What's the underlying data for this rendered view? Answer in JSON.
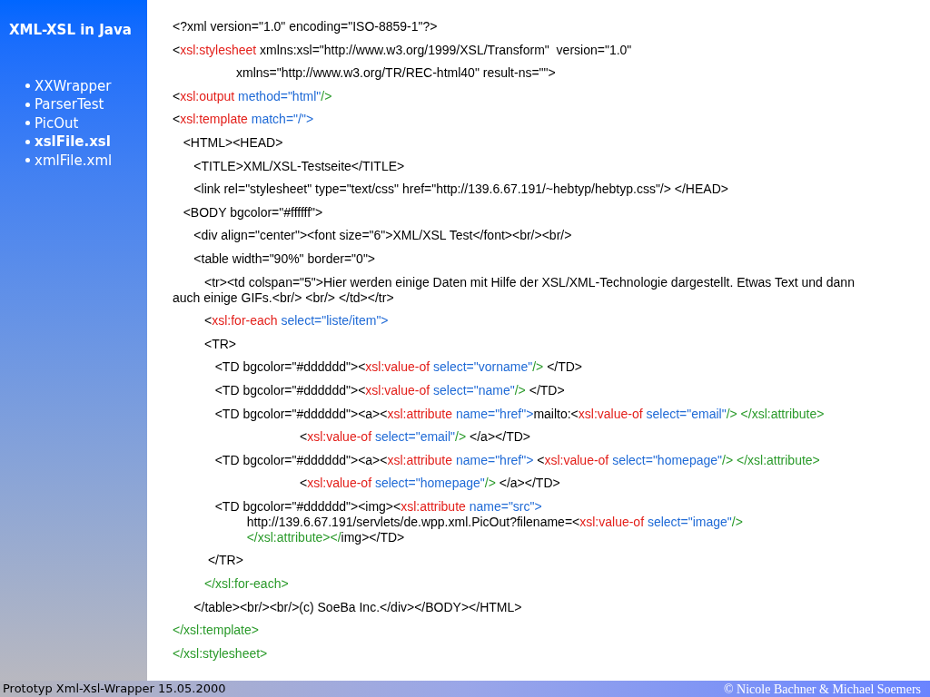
{
  "sidebar": {
    "title": "XML-XSL in Java",
    "items": [
      {
        "label": "XXWrapper",
        "selected": false
      },
      {
        "label": "ParserTest",
        "selected": false
      },
      {
        "label": "PicOut",
        "selected": false
      },
      {
        "label": "xslFile.xsl",
        "selected": true
      },
      {
        "label": "xmlFile.xml",
        "selected": false
      }
    ]
  },
  "code": [
    {
      "lines": [
        [
          {
            "kind": "text",
            "text": "<?xml version=\"1.0\" encoding=\"ISO-8859-1\"?>"
          }
        ]
      ]
    },
    {
      "lines": [
        [
          {
            "kind": "text",
            "text": "<"
          },
          {
            "kind": "keyword",
            "text": "xsl:stylesheet"
          },
          {
            "kind": "text",
            "text": " xmlns:xsl=\"http://www.w3.org/1999/XSL/Transform\"  version=\"1.0\""
          }
        ]
      ]
    },
    {
      "lines": [
        [
          {
            "kind": "text",
            "text": "                  xmlns=\"http://www.w3.org/TR/REC-html40\" result-ns=\"\">"
          }
        ]
      ]
    },
    {
      "lines": [
        [
          {
            "kind": "text",
            "text": "<"
          },
          {
            "kind": "keyword",
            "text": "xsl:output"
          },
          {
            "kind": "attr",
            "text": " method=\"html\""
          },
          {
            "kind": "close",
            "text": "/>"
          }
        ]
      ]
    },
    {
      "lines": [
        [
          {
            "kind": "text",
            "text": "<"
          },
          {
            "kind": "keyword",
            "text": "xsl:template"
          },
          {
            "kind": "attr",
            "text": " match=\"/\">"
          }
        ]
      ]
    },
    {
      "lines": [
        [
          {
            "kind": "text",
            "text": "   <HTML><HEAD>"
          }
        ]
      ]
    },
    {
      "lines": [
        [
          {
            "kind": "text",
            "text": "      <TITLE>XML/XSL-Testseite</TITLE>"
          }
        ]
      ]
    },
    {
      "lines": [
        [
          {
            "kind": "text",
            "text": "      <link rel=\"stylesheet\" type=\"text/css\" href=\"http://139.6.67.191/~hebtyp/hebtyp.css\"/> </HEAD>"
          }
        ]
      ]
    },
    {
      "lines": [
        [
          {
            "kind": "text",
            "text": "   <BODY bgcolor=\"#ffffff\">"
          }
        ]
      ]
    },
    {
      "lines": [
        [
          {
            "kind": "text",
            "text": "      <div align=\"center\"><font size=\"6\">XML/XSL Test</font><br/><br/>"
          }
        ]
      ]
    },
    {
      "lines": [
        [
          {
            "kind": "text",
            "text": "      <table width=\"90%\" border=\"0\">"
          }
        ]
      ]
    },
    {
      "lines": [
        [
          {
            "kind": "text",
            "text": "         <tr><td colspan=\"5\">Hier werden einige Daten mit Hilfe der XSL/XML-Technologie dargestellt. Etwas Text und dann auch einige GIFs.<br/> <br/> </td></tr>"
          }
        ]
      ]
    },
    {
      "lines": [
        [
          {
            "kind": "text",
            "text": "         <"
          },
          {
            "kind": "keyword",
            "text": "xsl:for-each"
          },
          {
            "kind": "attr",
            "text": " select=\"liste/item\">"
          }
        ]
      ]
    },
    {
      "lines": [
        [
          {
            "kind": "text",
            "text": "         <TR>"
          }
        ]
      ]
    },
    {
      "lines": [
        [
          {
            "kind": "text",
            "text": "            <TD bgcolor=\"#dddddd\"><"
          },
          {
            "kind": "keyword",
            "text": "xsl:value-of"
          },
          {
            "kind": "attr",
            "text": " select=\"vorname\""
          },
          {
            "kind": "close",
            "text": "/>"
          },
          {
            "kind": "text",
            "text": " </TD>"
          }
        ]
      ]
    },
    {
      "lines": [
        [
          {
            "kind": "text",
            "text": "            <TD bgcolor=\"#dddddd\"><"
          },
          {
            "kind": "keyword",
            "text": "xsl:value-of"
          },
          {
            "kind": "attr",
            "text": " select=\"name\""
          },
          {
            "kind": "close",
            "text": "/>"
          },
          {
            "kind": "text",
            "text": " </TD>"
          }
        ]
      ]
    },
    {
      "lines": [
        [
          {
            "kind": "text",
            "text": "            <TD bgcolor=\"#dddddd\"><a><"
          },
          {
            "kind": "keyword",
            "text": "xsl:attribute"
          },
          {
            "kind": "attr",
            "text": " name=\"href\">"
          },
          {
            "kind": "text",
            "text": "mailto:<"
          },
          {
            "kind": "keyword",
            "text": "xsl:value-of"
          },
          {
            "kind": "attr",
            "text": " select=\"email\""
          },
          {
            "kind": "close",
            "text": "/> </xsl:attribute>"
          }
        ]
      ]
    },
    {
      "lines": [
        [
          {
            "kind": "text",
            "text": "                                    <"
          },
          {
            "kind": "keyword",
            "text": "xsl:value-of"
          },
          {
            "kind": "attr",
            "text": " select=\"email\""
          },
          {
            "kind": "close",
            "text": "/>"
          },
          {
            "kind": "text",
            "text": " </a></TD>"
          }
        ]
      ]
    },
    {
      "lines": [
        [
          {
            "kind": "text",
            "text": "            <TD bgcolor=\"#dddddd\"><a><"
          },
          {
            "kind": "keyword",
            "text": "xsl:attribute"
          },
          {
            "kind": "attr",
            "text": " name=\"href\">"
          },
          {
            "kind": "text",
            "text": " <"
          },
          {
            "kind": "keyword",
            "text": "xsl:value-of"
          },
          {
            "kind": "attr",
            "text": " select=\"homepage\""
          },
          {
            "kind": "close",
            "text": "/> </xsl:attribute>"
          }
        ]
      ]
    },
    {
      "lines": [
        [
          {
            "kind": "text",
            "text": "                                    <"
          },
          {
            "kind": "keyword",
            "text": "xsl:value-of"
          },
          {
            "kind": "attr",
            "text": " select=\"homepage\""
          },
          {
            "kind": "close",
            "text": "/>"
          },
          {
            "kind": "text",
            "text": " </a></TD>"
          }
        ]
      ]
    },
    {
      "lines": [
        [
          {
            "kind": "text",
            "text": "            <TD bgcolor=\"#dddddd\"><img><"
          },
          {
            "kind": "keyword",
            "text": "xsl:attribute"
          },
          {
            "kind": "attr",
            "text": " name=\"src\">"
          }
        ],
        [
          {
            "kind": "text",
            "text": "                     http://139.6.67.191/servlets/de.wpp.xml.PicOut?filename=<"
          },
          {
            "kind": "keyword",
            "text": "xsl:value-of"
          },
          {
            "kind": "attr",
            "text": " select=\"image\""
          },
          {
            "kind": "close",
            "text": "/>"
          }
        ],
        [
          {
            "kind": "close",
            "text": "                     </xsl:attribute></"
          },
          {
            "kind": "text",
            "text": "img></TD>"
          }
        ]
      ]
    },
    {
      "lines": [
        [
          {
            "kind": "text",
            "text": "          </TR>"
          }
        ]
      ]
    },
    {
      "lines": [
        [
          {
            "kind": "close",
            "text": "         </xsl:for-each>"
          }
        ]
      ]
    },
    {
      "lines": [
        [
          {
            "kind": "text",
            "text": "      </table><br/><br/>(c) SoeBa Inc.</div></BODY></HTML>"
          }
        ]
      ]
    },
    {
      "lines": [
        [
          {
            "kind": "close",
            "text": "</xsl:template>"
          }
        ]
      ]
    },
    {
      "lines": [
        [
          {
            "kind": "close",
            "text": "</xsl:stylesheet>"
          }
        ]
      ]
    }
  ],
  "footer": {
    "left": "Prototyp Xml-Xsl-Wrapper 15.05.2000",
    "right": "© Nicole Bachner & Michael Soemers"
  }
}
